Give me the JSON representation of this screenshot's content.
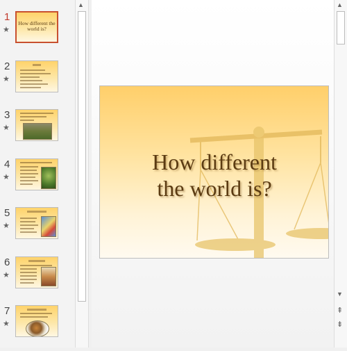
{
  "slides": [
    {
      "number": "1",
      "title": "How different the world is?"
    },
    {
      "number": "2"
    },
    {
      "number": "3"
    },
    {
      "number": "4"
    },
    {
      "number": "5"
    },
    {
      "number": "6"
    },
    {
      "number": "7"
    }
  ],
  "main_slide": {
    "title_line1": "How different",
    "title_line2": "the world is?"
  },
  "icons": {
    "star": "★",
    "up": "▲",
    "down": "▼",
    "prev": "⇞",
    "next": "⇟"
  }
}
